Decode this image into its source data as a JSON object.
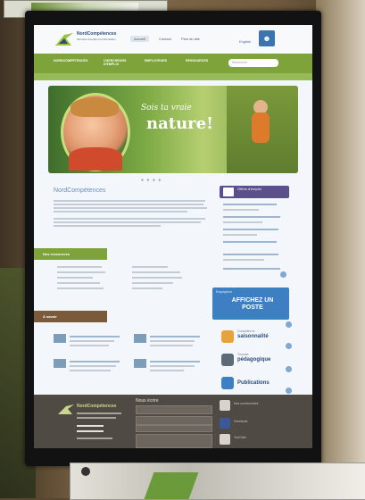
{
  "site": {
    "brand": "NordCompétences",
    "tagline": "Services d'emploi et d'orientation",
    "top_links": [
      "Accueil",
      "Contact",
      "Plan du site"
    ],
    "lang": "English",
    "user_icon": "user-icon"
  },
  "nav": {
    "items": [
      "Nordcompétences",
      "Chercheurs d'emploi",
      "Employeurs",
      "Ressources"
    ],
    "search_placeholder": "Recherche"
  },
  "banner": {
    "line1": "Sois ta vraie",
    "line2": "nature!"
  },
  "content": {
    "intro_title": "NordCompétences"
  },
  "sidebar": {
    "offres_label": "Offres d'emploi",
    "affichez_small": "Employeurs",
    "affichez_big": "AFFICHEZ UN POSTE",
    "features": [
      {
        "title": "saisonnalité",
        "small": "Consultez la",
        "icon": "leaf-icon"
      },
      {
        "title": "pédagogique",
        "small": "Trousse",
        "icon": "briefcase-icon"
      },
      {
        "title": "Publications",
        "small": "",
        "icon": "chart-icon"
      }
    ]
  },
  "sections": {
    "first": "Nos ressources",
    "second": "À savoir"
  },
  "footer": {
    "brand": "NordCompétences",
    "form_title": "Nous écrire",
    "social": [
      {
        "label": "Nos coordonnées",
        "icon": "mail-icon"
      },
      {
        "label": "Facebook",
        "icon": "facebook-icon"
      },
      {
        "label": "YouTube",
        "icon": "video-icon"
      }
    ]
  },
  "colors": {
    "nav_green": "#7da33a",
    "sidebar_blue": "#3e7fc4",
    "offres_purple": "#5b4f8c",
    "footer": "#4f4a43"
  }
}
